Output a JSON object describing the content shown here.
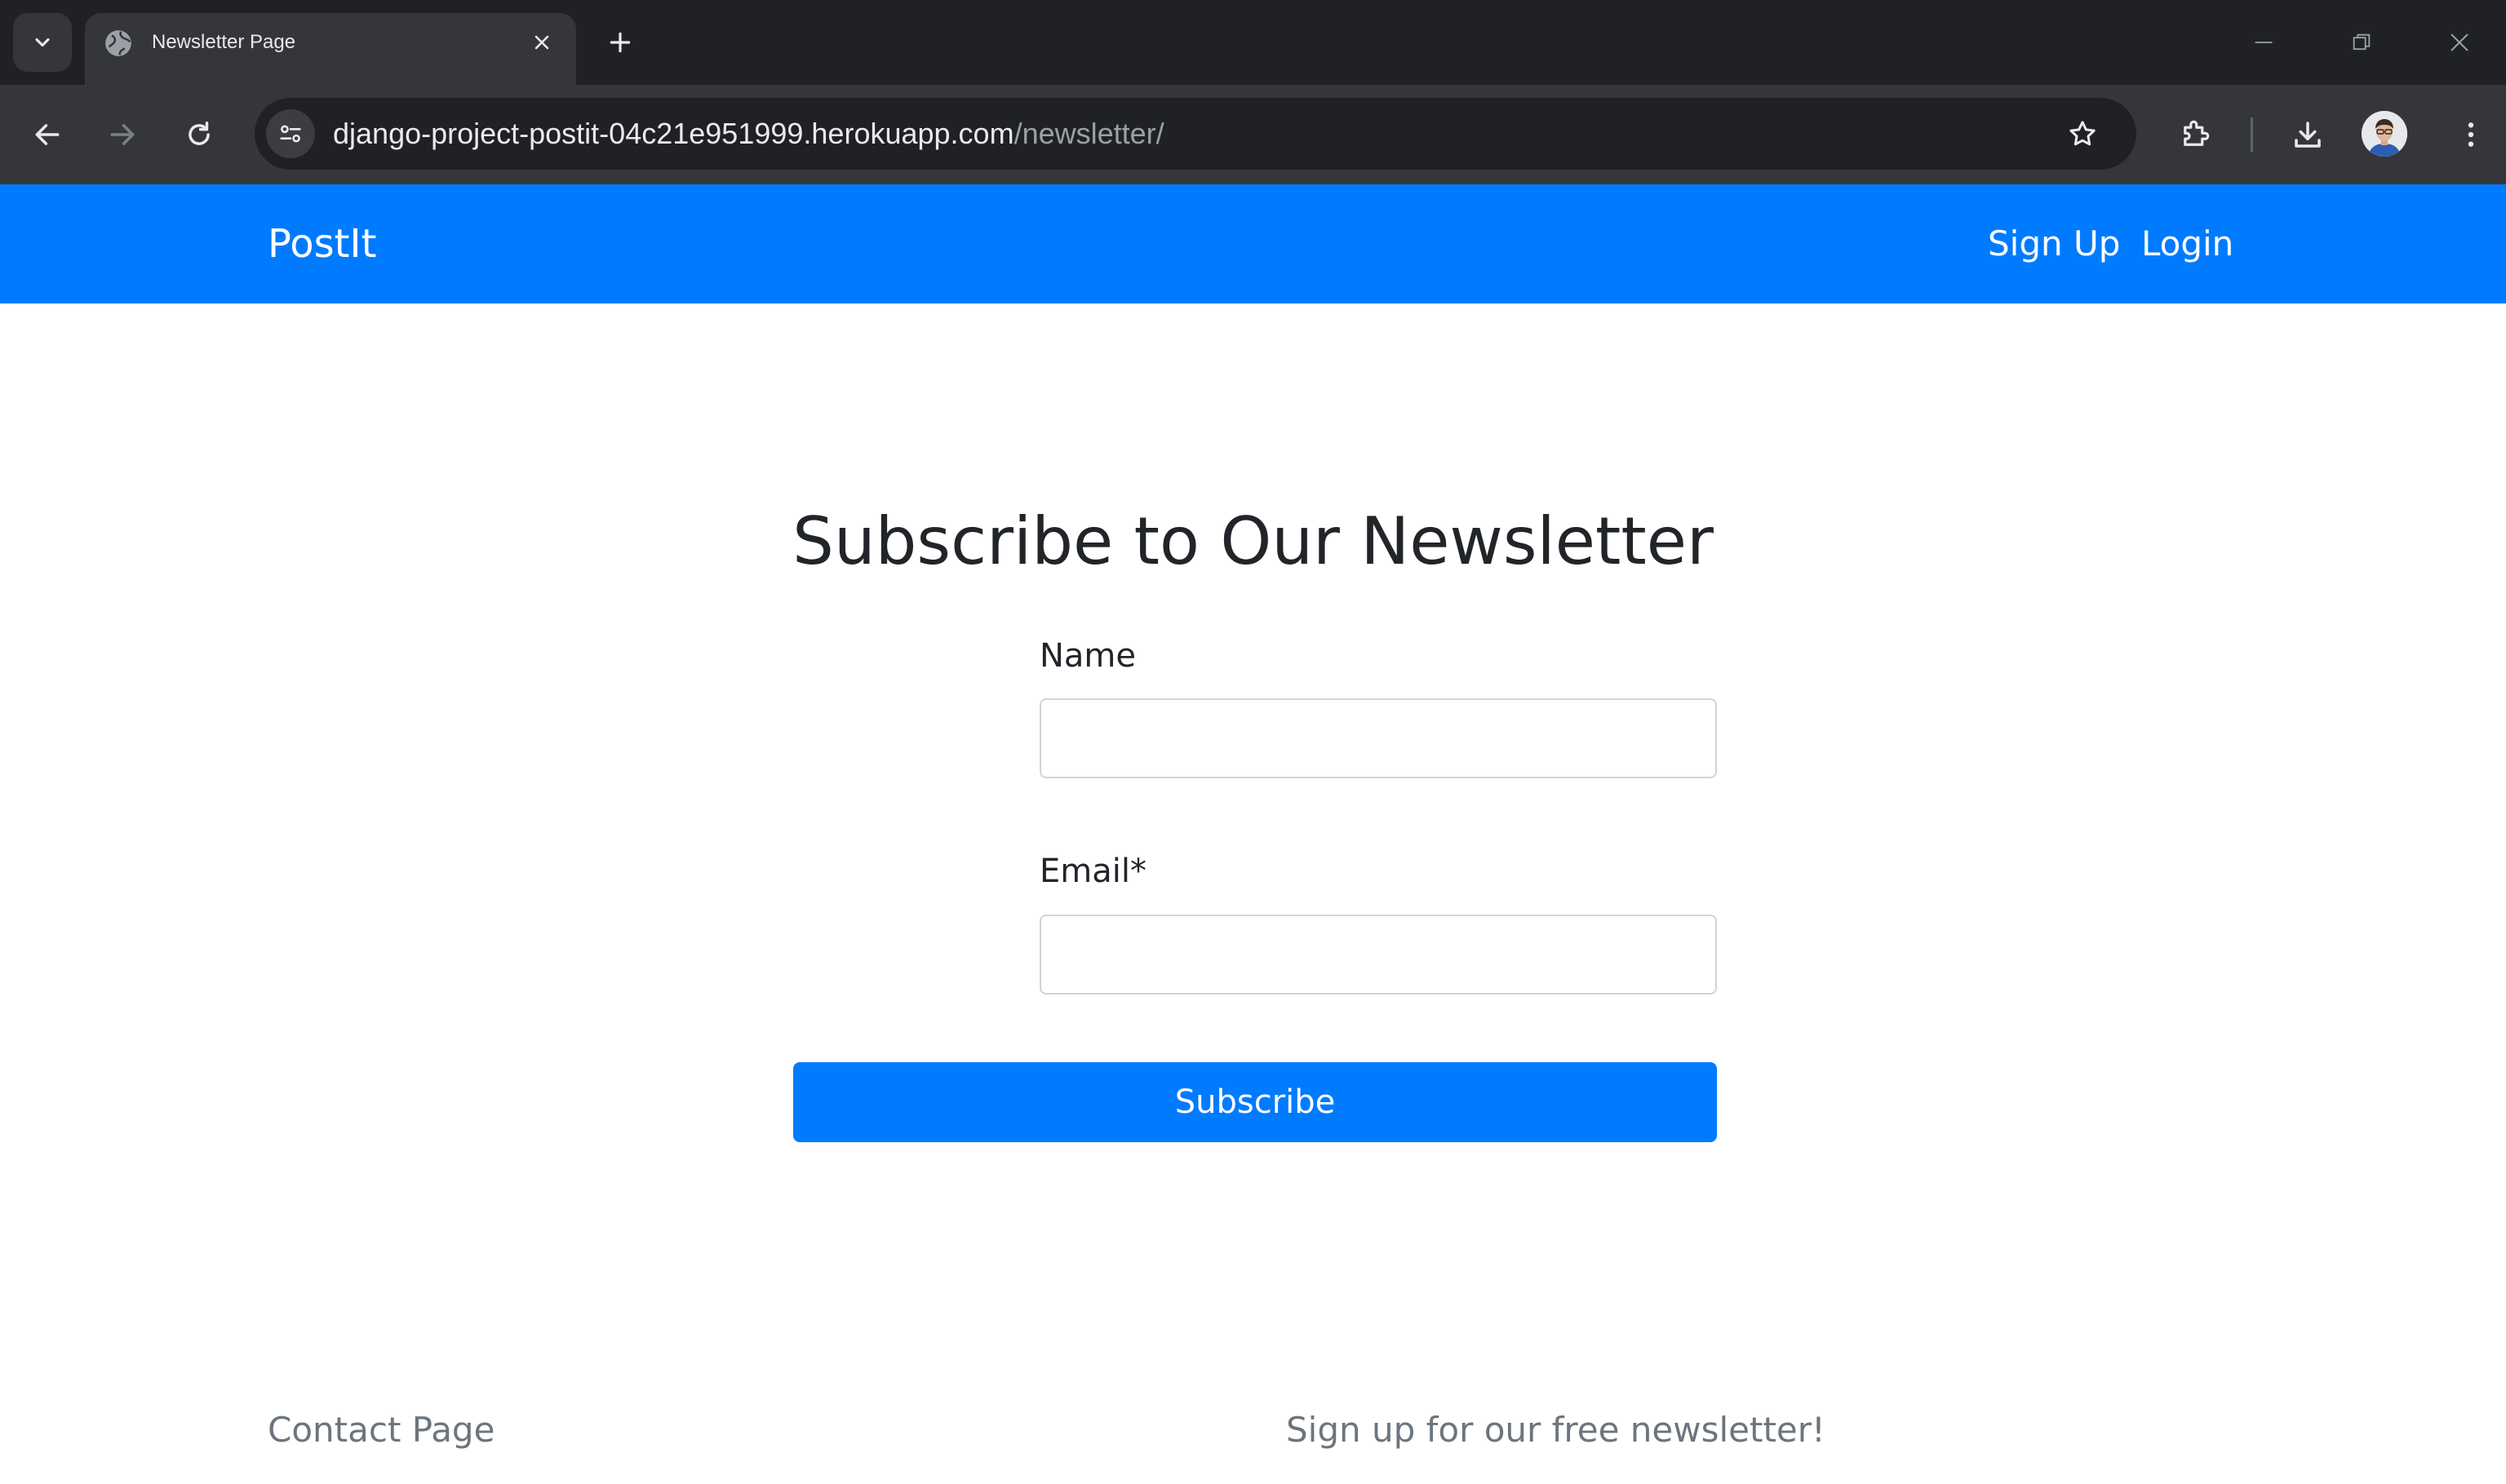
{
  "browser": {
    "tab": {
      "title": "Newsletter Page"
    },
    "address_bar": {
      "host": "django-project-postit-04c21e951999.herokuapp.com",
      "path": "/newsletter/"
    }
  },
  "navbar": {
    "brand": "PostIt",
    "links": [
      "Sign Up",
      "Login"
    ],
    "background": "#007bff"
  },
  "main": {
    "heading": "Subscribe to Our Newsletter",
    "fields": [
      {
        "label": "Name",
        "value": "",
        "placeholder": ""
      },
      {
        "label": "Email*",
        "value": "",
        "placeholder": ""
      }
    ],
    "submit_label": "Subscribe"
  },
  "footer": {
    "links": [
      "Contact Page",
      "Sign up for our free newsletter!"
    ]
  },
  "icons": [
    "tab-search-icon",
    "globe-icon",
    "close-icon",
    "plus-icon",
    "minimize-icon",
    "restore-icon",
    "window-close-icon",
    "back-arrow-icon",
    "forward-arrow-icon",
    "reload-icon",
    "site-info-icon",
    "star-icon",
    "extensions-icon",
    "download-icon",
    "menu-dots-icon"
  ]
}
